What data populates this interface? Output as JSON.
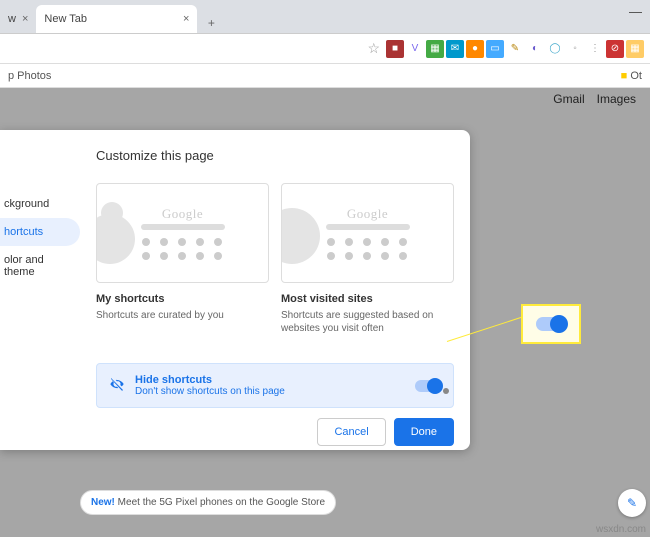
{
  "tabs": {
    "partial": "w",
    "active": "New Tab"
  },
  "bookmarks": {
    "left": "p Photos",
    "right": "Ot"
  },
  "page_links": {
    "gmail": "Gmail",
    "images": "Images"
  },
  "dialog": {
    "title": "Customize this page",
    "sidebar": {
      "background": "ckground",
      "shortcuts": "hortcuts",
      "color": "olor and theme"
    },
    "cards": {
      "logo": "Google",
      "my": {
        "title": "My shortcuts",
        "desc": "Shortcuts are curated by you"
      },
      "most": {
        "title": "Most visited sites",
        "desc": "Shortcuts are suggested based on websites you visit often"
      }
    },
    "hide": {
      "title": "Hide shortcuts",
      "desc": "Don't show shortcuts on this page"
    },
    "actions": {
      "cancel": "Cancel",
      "done": "Done"
    }
  },
  "promo": {
    "new": "New!",
    "text": " Meet the 5G Pixel phones on the Google Store"
  },
  "watermark": "wsxdn.com"
}
